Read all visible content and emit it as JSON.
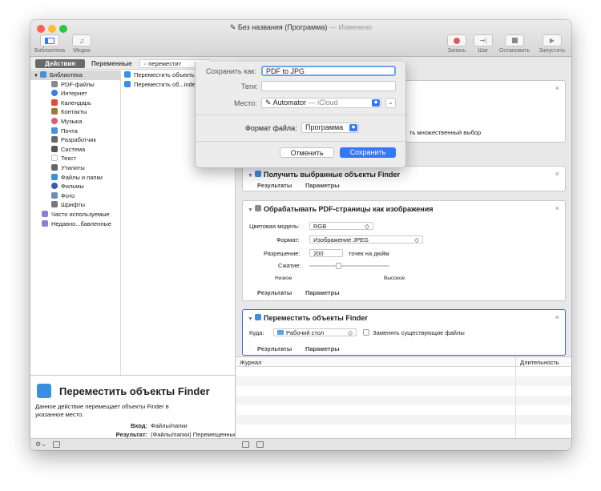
{
  "window": {
    "title": "Без названия (Программа)",
    "title_suffix": "— Изменено"
  },
  "toolbar": {
    "left": [
      {
        "label": "Библиотека"
      },
      {
        "label": "Медиа"
      }
    ],
    "right": [
      {
        "label": "Запись"
      },
      {
        "label": "Шаг"
      },
      {
        "label": "Остановить"
      },
      {
        "label": "Запустить"
      }
    ]
  },
  "tabs": {
    "actions": "Действия",
    "variables": "Переменные"
  },
  "search": {
    "value": "переместит"
  },
  "library": [
    {
      "label": "Библиотека",
      "icon": "library-icon",
      "color": "#4a90d9"
    },
    {
      "label": "PDF-файлы",
      "icon": "pdf-icon",
      "color": "#8a8a8a"
    },
    {
      "label": "Интернет",
      "icon": "globe-icon",
      "color": "#3b7dd8"
    },
    {
      "label": "Календарь",
      "icon": "calendar-icon",
      "color": "#e04b3a"
    },
    {
      "label": "Контакты",
      "icon": "contacts-icon",
      "color": "#a0763e"
    },
    {
      "label": "Музыка",
      "icon": "music-icon",
      "color": "#e2577c"
    },
    {
      "label": "Почта",
      "icon": "mail-icon",
      "color": "#4a8fe0"
    },
    {
      "label": "Разработчик",
      "icon": "developer-icon",
      "color": "#666666"
    },
    {
      "label": "Система",
      "icon": "system-icon",
      "color": "#555555"
    },
    {
      "label": "Текст",
      "icon": "text-icon",
      "color": "#bbbbbb"
    },
    {
      "label": "Утилиты",
      "icon": "utilities-icon",
      "color": "#666666"
    },
    {
      "label": "Файлы и папки",
      "icon": "finder-icon",
      "color": "#3a8fe0"
    },
    {
      "label": "Фильмы",
      "icon": "movies-icon",
      "color": "#3a5ea8"
    },
    {
      "label": "Фото",
      "icon": "photos-icon",
      "color": "#6f8fb8"
    },
    {
      "label": "Шрифты",
      "icon": "fonts-icon",
      "color": "#777777"
    },
    {
      "label": "Часто используемые",
      "icon": "folder-icon",
      "color": "#8c7fd8"
    },
    {
      "label": "Недавно...бавленные",
      "icon": "folder-icon",
      "color": "#8c7fd8"
    }
  ],
  "actions_list": [
    {
      "label": "Переместить объекты Finder"
    },
    {
      "label": "Переместить об...index"
    }
  ],
  "description": {
    "title": "Переместить объекты Finder",
    "text": "Данное действие перемещает объекты Finder в указанное место.",
    "input_label": "Вход:",
    "input_value": "Файлы/папки",
    "result_label": "Результат:",
    "result_value": "(Файлы/папки) Перемещенные объекты"
  },
  "workflow": {
    "partial_text": "ть множественный выбор",
    "card_finder_title": "Получить выбранные объекты Finder",
    "card_pdf": {
      "title": "Обрабатывать PDF-страницы как изображения",
      "color_model_label": "Цветовая модель:",
      "color_model_value": "RGB",
      "format_label": "Формат:",
      "format_value": "Изображение JPEG",
      "resolution_label": "Разрешение:",
      "resolution_value": "200",
      "resolution_unit": "точек на дюйм",
      "compression_label": "Сжатие:",
      "compression_level": 0.35,
      "low": "Низкое",
      "high": "Высокое"
    },
    "card_move": {
      "title": "Переместить объекты Finder",
      "to_label": "Куда:",
      "to_value": "Рабочий стол",
      "replace_label": "Заменять существующие файлы"
    },
    "results": "Результаты",
    "params": "Параметры"
  },
  "log": {
    "journal": "Журнал",
    "duration": "Длительность"
  },
  "save_sheet": {
    "save_as_label": "Сохранить как:",
    "save_as_value": "PDF to JPG",
    "tags_label": "Теги:",
    "place_label": "Место:",
    "place_value": "Automator",
    "place_suffix": "— iCloud",
    "format_label": "Формат файла:",
    "format_value": "Программа",
    "cancel": "Отменить",
    "save": "Сохранить"
  },
  "colors": {
    "accent": "#3478f6",
    "selection_border": "#2f6bd5"
  }
}
